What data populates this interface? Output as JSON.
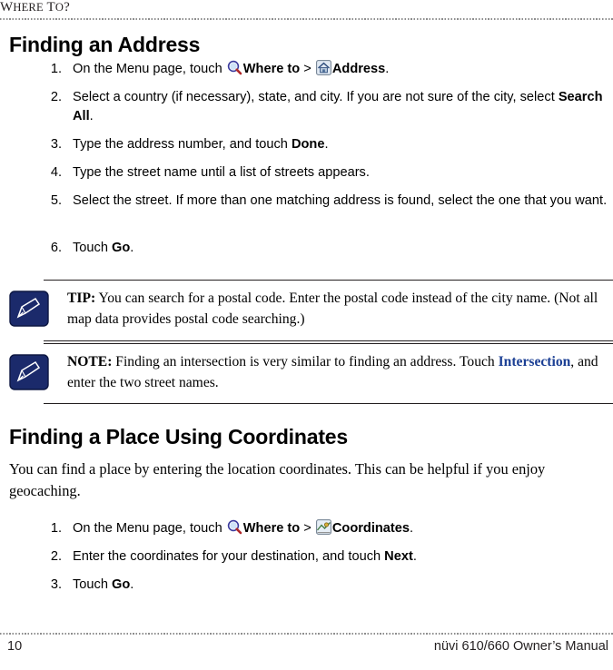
{
  "running_header": {
    "prefix": "W",
    "small_caps_1": "HERE",
    "mid": " T",
    "small_caps_2": "O",
    "suffix": "?",
    "full_text": "WHERE TO?"
  },
  "sections": {
    "address": {
      "heading": "Finding an Address",
      "steps": [
        {
          "num": "1.",
          "parts": [
            {
              "t": "text",
              "v": "On the Menu page, touch "
            },
            {
              "t": "icon",
              "v": "magnifier-icon"
            },
            {
              "t": "bold",
              "v": "Where to"
            },
            {
              "t": "text",
              "v": " > "
            },
            {
              "t": "icon",
              "v": "address-house-icon"
            },
            {
              "t": "bold",
              "v": "Address"
            },
            {
              "t": "text",
              "v": "."
            }
          ]
        },
        {
          "num": "2.",
          "parts": [
            {
              "t": "text",
              "v": "Select a country (if necessary), state, and city. If you are not sure of the city, select "
            },
            {
              "t": "bold",
              "v": "Search All"
            },
            {
              "t": "text",
              "v": "."
            }
          ]
        },
        {
          "num": "3.",
          "parts": [
            {
              "t": "text",
              "v": "Type the address number, and touch "
            },
            {
              "t": "bold",
              "v": "Done"
            },
            {
              "t": "text",
              "v": "."
            }
          ]
        },
        {
          "num": "4.",
          "parts": [
            {
              "t": "text",
              "v": "Type the street name until a list of streets appears."
            }
          ]
        },
        {
          "num": "5.",
          "parts": [
            {
              "t": "text",
              "v": "Select the street. If more than one matching address is found, select the one that you want."
            }
          ]
        },
        {
          "num": "6.",
          "parts": [
            {
              "t": "text",
              "v": "Touch "
            },
            {
              "t": "bold",
              "v": "Go"
            },
            {
              "t": "text",
              "v": "."
            }
          ]
        }
      ]
    },
    "coordinates": {
      "heading": "Finding a Place Using Coordinates",
      "intro": "You can find a place by entering the location coordinates. This can be helpful if you enjoy geocaching.",
      "steps": [
        {
          "num": "1.",
          "parts": [
            {
              "t": "text",
              "v": "On the Menu page, touch "
            },
            {
              "t": "icon",
              "v": "magnifier-icon"
            },
            {
              "t": "bold",
              "v": "Where to"
            },
            {
              "t": "text",
              "v": " > "
            },
            {
              "t": "icon",
              "v": "coordinates-icon"
            },
            {
              "t": "bold",
              "v": "Coordinates"
            },
            {
              "t": "text",
              "v": "."
            }
          ]
        },
        {
          "num": "2.",
          "parts": [
            {
              "t": "text",
              "v": "Enter the coordinates for your destination, and touch "
            },
            {
              "t": "bold",
              "v": "Next"
            },
            {
              "t": "text",
              "v": "."
            }
          ]
        },
        {
          "num": "3.",
          "parts": [
            {
              "t": "text",
              "v": "Touch "
            },
            {
              "t": "bold",
              "v": "Go"
            },
            {
              "t": "text",
              "v": "."
            }
          ]
        }
      ]
    }
  },
  "callouts": [
    {
      "label": "TIP:",
      "icon": "note-pencil-badge",
      "text": " You can search for a postal code. Enter the postal code instead of the city name. (Not all map data provides postal code searching.)"
    },
    {
      "label": "NOTE:",
      "icon": "note-pencil-badge",
      "text_before": " Finding an intersection is very similar to finding an address. Touch ",
      "link": "Intersection",
      "text_after": ", and enter the two street names."
    }
  ],
  "footer": {
    "page_number": "10",
    "manual_title": "nüvi 610/660 Owner’s Manual"
  },
  "colors": {
    "link_blue": "#1b3f94",
    "text": "#000000",
    "header_gray": "#231f20",
    "badge_navy": "#1b2a6b"
  }
}
